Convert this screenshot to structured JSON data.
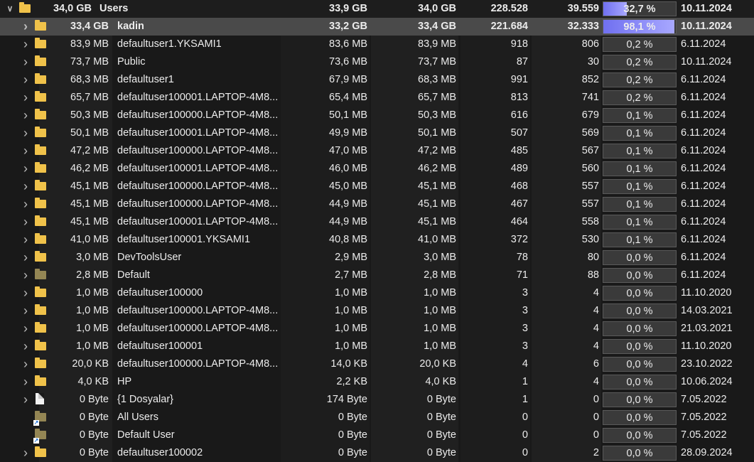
{
  "bands": {
    "size": "#202020",
    "alloc": "#1d1d1d",
    "disk": "#202020",
    "files": "#1d1d1d",
    "folders": "#202020"
  },
  "rows": [
    {
      "chevron": "expanded",
      "icon": "folder-icon",
      "size": "34,0 GB",
      "name": "Users",
      "alloc": "33,9 GB",
      "disk": "34,0 GB",
      "files": "228.528",
      "folders": "39.559",
      "pct": "32,7 %",
      "pct_value": 0.327,
      "date": "10.11.2024",
      "level": 0,
      "style": "root"
    },
    {
      "chevron": "collapsed",
      "icon": "folder-icon",
      "size": "33,4 GB",
      "name": "kadin",
      "alloc": "33,2 GB",
      "disk": "33,4 GB",
      "files": "221.684",
      "folders": "32.333",
      "pct": "98,1 %",
      "pct_value": 0.981,
      "date": "10.11.2024",
      "level": 1,
      "style": "selected"
    },
    {
      "chevron": "collapsed",
      "icon": "folder-icon",
      "size": "83,9 MB",
      "name": "defaultuser1.YKSAMI1",
      "alloc": "83,6 MB",
      "disk": "83,9 MB",
      "files": "918",
      "folders": "806",
      "pct": "0,2 %",
      "pct_value": 0.002,
      "date": "6.11.2024",
      "level": 1
    },
    {
      "chevron": "collapsed",
      "icon": "folder-icon",
      "size": "73,7 MB",
      "name": "Public",
      "alloc": "73,6 MB",
      "disk": "73,7 MB",
      "files": "87",
      "folders": "30",
      "pct": "0,2 %",
      "pct_value": 0.002,
      "date": "10.11.2024",
      "level": 1
    },
    {
      "chevron": "collapsed",
      "icon": "folder-icon",
      "size": "68,3 MB",
      "name": "defaultuser1",
      "alloc": "67,9 MB",
      "disk": "68,3 MB",
      "files": "991",
      "folders": "852",
      "pct": "0,2 %",
      "pct_value": 0.002,
      "date": "6.11.2024",
      "level": 1
    },
    {
      "chevron": "collapsed",
      "icon": "folder-icon",
      "size": "65,7 MB",
      "name": "defaultuser100001.LAPTOP-4M8...",
      "alloc": "65,4 MB",
      "disk": "65,7 MB",
      "files": "813",
      "folders": "741",
      "pct": "0,2 %",
      "pct_value": 0.002,
      "date": "6.11.2024",
      "level": 1
    },
    {
      "chevron": "collapsed",
      "icon": "folder-icon",
      "size": "50,3 MB",
      "name": "defaultuser100000.LAPTOP-4M8...",
      "alloc": "50,1 MB",
      "disk": "50,3 MB",
      "files": "616",
      "folders": "679",
      "pct": "0,1 %",
      "pct_value": 0.001,
      "date": "6.11.2024",
      "level": 1
    },
    {
      "chevron": "collapsed",
      "icon": "folder-icon",
      "size": "50,1 MB",
      "name": "defaultuser100001.LAPTOP-4M8...",
      "alloc": "49,9 MB",
      "disk": "50,1 MB",
      "files": "507",
      "folders": "569",
      "pct": "0,1 %",
      "pct_value": 0.001,
      "date": "6.11.2024",
      "level": 1
    },
    {
      "chevron": "collapsed",
      "icon": "folder-icon",
      "size": "47,2 MB",
      "name": "defaultuser100000.LAPTOP-4M8...",
      "alloc": "47,0 MB",
      "disk": "47,2 MB",
      "files": "485",
      "folders": "567",
      "pct": "0,1 %",
      "pct_value": 0.001,
      "date": "6.11.2024",
      "level": 1
    },
    {
      "chevron": "collapsed",
      "icon": "folder-icon",
      "size": "46,2 MB",
      "name": "defaultuser100001.LAPTOP-4M8...",
      "alloc": "46,0 MB",
      "disk": "46,2 MB",
      "files": "489",
      "folders": "560",
      "pct": "0,1 %",
      "pct_value": 0.001,
      "date": "6.11.2024",
      "level": 1
    },
    {
      "chevron": "collapsed",
      "icon": "folder-icon",
      "size": "45,1 MB",
      "name": "defaultuser100000.LAPTOP-4M8...",
      "alloc": "45,0 MB",
      "disk": "45,1 MB",
      "files": "468",
      "folders": "557",
      "pct": "0,1 %",
      "pct_value": 0.001,
      "date": "6.11.2024",
      "level": 1
    },
    {
      "chevron": "collapsed",
      "icon": "folder-icon",
      "size": "45,1 MB",
      "name": "defaultuser100000.LAPTOP-4M8...",
      "alloc": "44,9 MB",
      "disk": "45,1 MB",
      "files": "467",
      "folders": "557",
      "pct": "0,1 %",
      "pct_value": 0.001,
      "date": "6.11.2024",
      "level": 1
    },
    {
      "chevron": "collapsed",
      "icon": "folder-icon",
      "size": "45,1 MB",
      "name": "defaultuser100001.LAPTOP-4M8...",
      "alloc": "44,9 MB",
      "disk": "45,1 MB",
      "files": "464",
      "folders": "558",
      "pct": "0,1 %",
      "pct_value": 0.001,
      "date": "6.11.2024",
      "level": 1
    },
    {
      "chevron": "collapsed",
      "icon": "folder-icon",
      "size": "41,0 MB",
      "name": "defaultuser100001.YKSAMI1",
      "alloc": "40,8 MB",
      "disk": "41,0 MB",
      "files": "372",
      "folders": "530",
      "pct": "0,1 %",
      "pct_value": 0.001,
      "date": "6.11.2024",
      "level": 1
    },
    {
      "chevron": "collapsed",
      "icon": "folder-icon",
      "size": "3,0 MB",
      "name": "DevToolsUser",
      "alloc": "2,9 MB",
      "disk": "3,0 MB",
      "files": "78",
      "folders": "80",
      "pct": "0,0 %",
      "pct_value": 0,
      "date": "6.11.2024",
      "level": 1
    },
    {
      "chevron": "collapsed",
      "icon": "folder-hidden-icon",
      "size": "2,8 MB",
      "name": "Default",
      "alloc": "2,7 MB",
      "disk": "2,8 MB",
      "files": "71",
      "folders": "88",
      "pct": "0,0 %",
      "pct_value": 0,
      "date": "6.11.2024",
      "level": 1
    },
    {
      "chevron": "collapsed",
      "icon": "folder-icon",
      "size": "1,0 MB",
      "name": "defaultuser100000",
      "alloc": "1,0 MB",
      "disk": "1,0 MB",
      "files": "3",
      "folders": "4",
      "pct": "0,0 %",
      "pct_value": 0,
      "date": "11.10.2020",
      "level": 1
    },
    {
      "chevron": "collapsed",
      "icon": "folder-icon",
      "size": "1,0 MB",
      "name": "defaultuser100000.LAPTOP-4M8...",
      "alloc": "1,0 MB",
      "disk": "1,0 MB",
      "files": "3",
      "folders": "4",
      "pct": "0,0 %",
      "pct_value": 0,
      "date": "14.03.2021",
      "level": 1
    },
    {
      "chevron": "collapsed",
      "icon": "folder-icon",
      "size": "1,0 MB",
      "name": "defaultuser100000.LAPTOP-4M8...",
      "alloc": "1,0 MB",
      "disk": "1,0 MB",
      "files": "3",
      "folders": "4",
      "pct": "0,0 %",
      "pct_value": 0,
      "date": "21.03.2021",
      "level": 1
    },
    {
      "chevron": "collapsed",
      "icon": "folder-icon",
      "size": "1,0 MB",
      "name": "defaultuser100001",
      "alloc": "1,0 MB",
      "disk": "1,0 MB",
      "files": "3",
      "folders": "4",
      "pct": "0,0 %",
      "pct_value": 0,
      "date": "11.10.2020",
      "level": 1
    },
    {
      "chevron": "collapsed",
      "icon": "folder-icon",
      "size": "20,0 KB",
      "name": "defaultuser100000.LAPTOP-4M8...",
      "alloc": "14,0 KB",
      "disk": "20,0 KB",
      "files": "4",
      "folders": "6",
      "pct": "0,0 %",
      "pct_value": 0,
      "date": "23.10.2022",
      "level": 1
    },
    {
      "chevron": "collapsed",
      "icon": "folder-icon",
      "size": "4,0 KB",
      "name": "HP",
      "alloc": "2,2 KB",
      "disk": "4,0 KB",
      "files": "1",
      "folders": "4",
      "pct": "0,0 %",
      "pct_value": 0,
      "date": "10.06.2024",
      "level": 1
    },
    {
      "chevron": "collapsed",
      "icon": "file-icon",
      "size": "0 Byte",
      "name": "{1 Dosyalar}",
      "alloc": "174 Byte",
      "disk": "0 Byte",
      "files": "1",
      "folders": "0",
      "pct": "0,0 %",
      "pct_value": 0,
      "date": "7.05.2022",
      "level": 1
    },
    {
      "chevron": "none",
      "icon": "folder-shortcut-icon",
      "size": "0 Byte",
      "name": "All Users",
      "alloc": "0 Byte",
      "disk": "0 Byte",
      "files": "0",
      "folders": "0",
      "pct": "0,0 %",
      "pct_value": 0,
      "date": "7.05.2022",
      "level": 1
    },
    {
      "chevron": "none",
      "icon": "folder-shortcut-icon",
      "size": "0 Byte",
      "name": "Default User",
      "alloc": "0 Byte",
      "disk": "0 Byte",
      "files": "0",
      "folders": "0",
      "pct": "0,0 %",
      "pct_value": 0,
      "date": "7.05.2022",
      "level": 1
    },
    {
      "chevron": "collapsed",
      "icon": "folder-icon",
      "size": "0 Byte",
      "name": "defaultuser100002",
      "alloc": "0 Byte",
      "disk": "0 Byte",
      "files": "0",
      "folders": "2",
      "pct": "0,0 %",
      "pct_value": 0,
      "date": "28.09.2024",
      "level": 1
    }
  ]
}
